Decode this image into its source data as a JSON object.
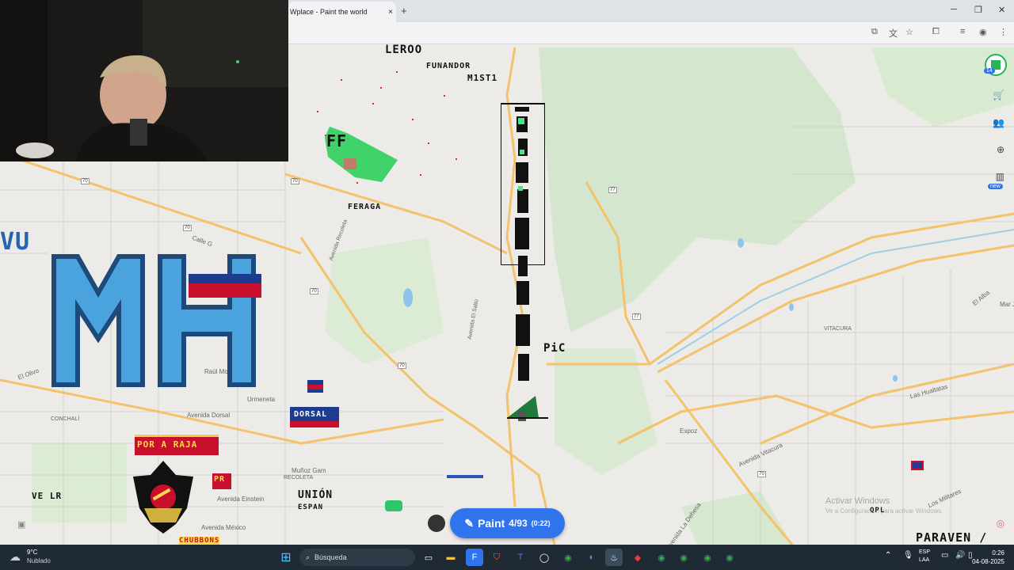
{
  "browser": {
    "tab_title": "Wplace - Paint the world",
    "tab_close": "×",
    "new_tab": "+"
  },
  "map": {
    "road_labels": [
      "70",
      "70",
      "70",
      "70",
      "70",
      "70",
      "77",
      "77",
      "77",
      "77",
      "70",
      "70"
    ],
    "place_labels": {
      "calle_g": "Calle G",
      "avenida_recoleta": "Avenida Recoleta",
      "avenida_el_salto": "Avenida El Salto",
      "raul_mo": "Raúl Mo",
      "el_olivo": "El Olivo",
      "conchali": "CONCHALÍ",
      "urmeneta": "Urmeneta",
      "avenida_dorsal": "Avenida Dorsal",
      "recoleta": "RECOLETA",
      "munoz_gamero": "Muñoz Gam",
      "avenida_einstein": "Avenida Einstein",
      "avenida_mexico": "Avenida México",
      "vitacura": "VITACURA",
      "las_hualtatas": "Las Hualtatas",
      "espoz": "Espoz",
      "avenida_vitacura": "Avenida Vitacura",
      "avenida_la_dehesa": "Avenida La Dehesa",
      "los_militares": "Los Militares",
      "el_alba": "El Alba",
      "mar_j": "Mar J"
    },
    "pixel_art": {
      "funandor": "FUNANDOR",
      "mist": "M1ST1",
      "ferega": "FERAGA",
      "mh": "MH",
      "pic": "PiC",
      "dorsal": "DORSAL",
      "por_a_raja": "POR A RAJA",
      "union": "UNIÓN",
      "espan": "ESPAN",
      "pr": "PR",
      "ve_lr": "VE LR",
      "ff": "FF",
      "paraven": "PARAVEN /",
      "vu": "VU",
      "qpl": "QPL",
      "top_text": "LEROO",
      "bottom_text": "CHUBBONS"
    }
  },
  "controls": {
    "badge": "14",
    "new_badge": "new"
  },
  "paint_button": {
    "label": "Paint",
    "count": "4/93",
    "timer": "(0:22)"
  },
  "watermark": {
    "line1": "Activar Windows",
    "line2": "Ve a Configuración para activar Windows."
  },
  "taskbar": {
    "weather_temp": "9°C",
    "weather_desc": "Nublado",
    "search_placeholder": "Búsqueda",
    "lang1": "ESP",
    "lang2": "LAA",
    "time": "0:26",
    "date": "04-08-2025"
  },
  "colors": {
    "paint_button": "#2f74ec",
    "taskbar": "#1f2a35",
    "map_bg": "#ecebe7",
    "mh_blue": "#4aa3dd",
    "mh_dark": "#1d4a7a"
  }
}
